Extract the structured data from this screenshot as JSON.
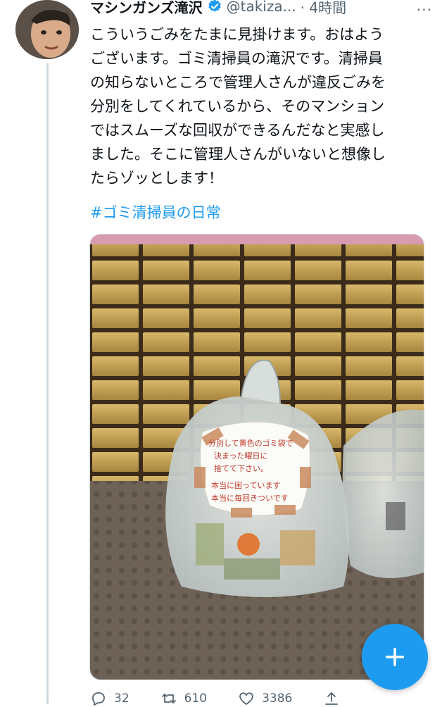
{
  "tweet": {
    "author_name": "マシンガンズ滝沢",
    "handle": "@takiza...",
    "time": "· 4時間",
    "more": "...",
    "body": [
      "こういうごみをたまに見掛けます。おはよう",
      "ございます。ゴミ清掃員の滝沢です。清掃員",
      "の知らないところで管理人さんが違反ごみを",
      "分別をしてくれているから、そのマンション",
      "ではスムーズな回収ができるんだなと実感し",
      "ました。そこに管理人さんがいないと想像し",
      "たらゾッとします！"
    ],
    "hashtag": "#ゴミ清掃員の日常",
    "note": [
      "分別して黄色のゴミ袋で",
      "決まった曜日に",
      "捨てて下さい。",
      "本当に困っています",
      "本当に毎回きついです"
    ]
  },
  "actions": {
    "reply_count": "32",
    "retweet_count": "610",
    "like_count": "3386"
  },
  "colors": {
    "accent": "#1d9bf0",
    "muted": "#536471"
  },
  "icons": {
    "verified": "verified-badge-icon",
    "reply": "reply-icon",
    "retweet": "retweet-icon",
    "like": "like-icon",
    "share": "share-icon",
    "compose": "plus-icon"
  }
}
